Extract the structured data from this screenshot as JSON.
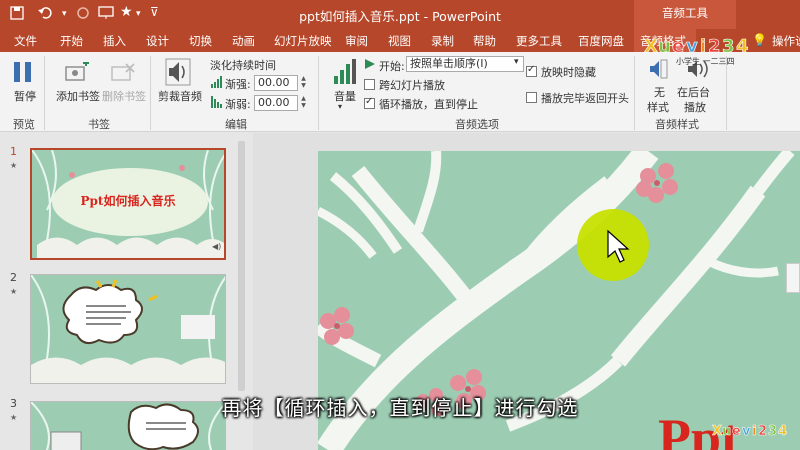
{
  "window": {
    "title": "ppt如何插入音乐.ppt - PowerPoint",
    "context_tab": "音频工具"
  },
  "tabs": [
    {
      "label": "文件"
    },
    {
      "label": "开始"
    },
    {
      "label": "插入"
    },
    {
      "label": "设计"
    },
    {
      "label": "切换"
    },
    {
      "label": "动画"
    },
    {
      "label": "幻灯片放映"
    },
    {
      "label": "审阅"
    },
    {
      "label": "视图"
    },
    {
      "label": "录制"
    },
    {
      "label": "帮助"
    },
    {
      "label": "更多工具"
    },
    {
      "label": "百度网盘"
    },
    {
      "label": "音频格式"
    },
    {
      "label": "播放"
    },
    {
      "label": "操作说"
    }
  ],
  "ribbon": {
    "preview": {
      "play_label": "暂停",
      "group": "预览"
    },
    "bookmarks": {
      "add_label": "添加书签",
      "remove_label": "删除书签",
      "group": "书签"
    },
    "editing": {
      "trim_label": "剪裁音频",
      "fade_title": "淡化持续时间",
      "fade_in_label": "渐强:",
      "fade_in_value": "00.00",
      "fade_out_label": "渐弱:",
      "fade_out_value": "00.00",
      "group": "编辑"
    },
    "audio_options": {
      "volume_label": "音量",
      "start_label": "开始:",
      "start_value": "按照单击顺序(I)",
      "play_across_slides": {
        "label": "跨幻灯片播放",
        "checked": false
      },
      "loop_until_stopped": {
        "label": "循环播放，直到停止",
        "checked": true
      },
      "hide_during_show": {
        "label": "放映时隐藏",
        "checked": true
      },
      "rewind_after_playing": {
        "label": "播放完毕返回开头",
        "checked": false
      },
      "group": "音频选项"
    },
    "audio_styles": {
      "no_style_label_1": "无",
      "no_style_label_2": "样式",
      "bg_play_label_1": "在后台",
      "bg_play_label_2": "播放",
      "group": "音频样式"
    }
  },
  "slides": [
    {
      "number": "1",
      "title": "Ppt如何插入音乐",
      "active": true
    },
    {
      "number": "2",
      "title": "",
      "active": false
    },
    {
      "number": "3",
      "title": "",
      "active": false
    }
  ],
  "watermark": {
    "text_top": "小学生",
    "text_bottom": "一二三四"
  },
  "subtitle": "再将【循环插入，直到停止】进行勾选",
  "colors": {
    "accent": "#b7472a",
    "slide_bg": "#9ccdb3",
    "cursor_highlight": "#c7e000"
  }
}
